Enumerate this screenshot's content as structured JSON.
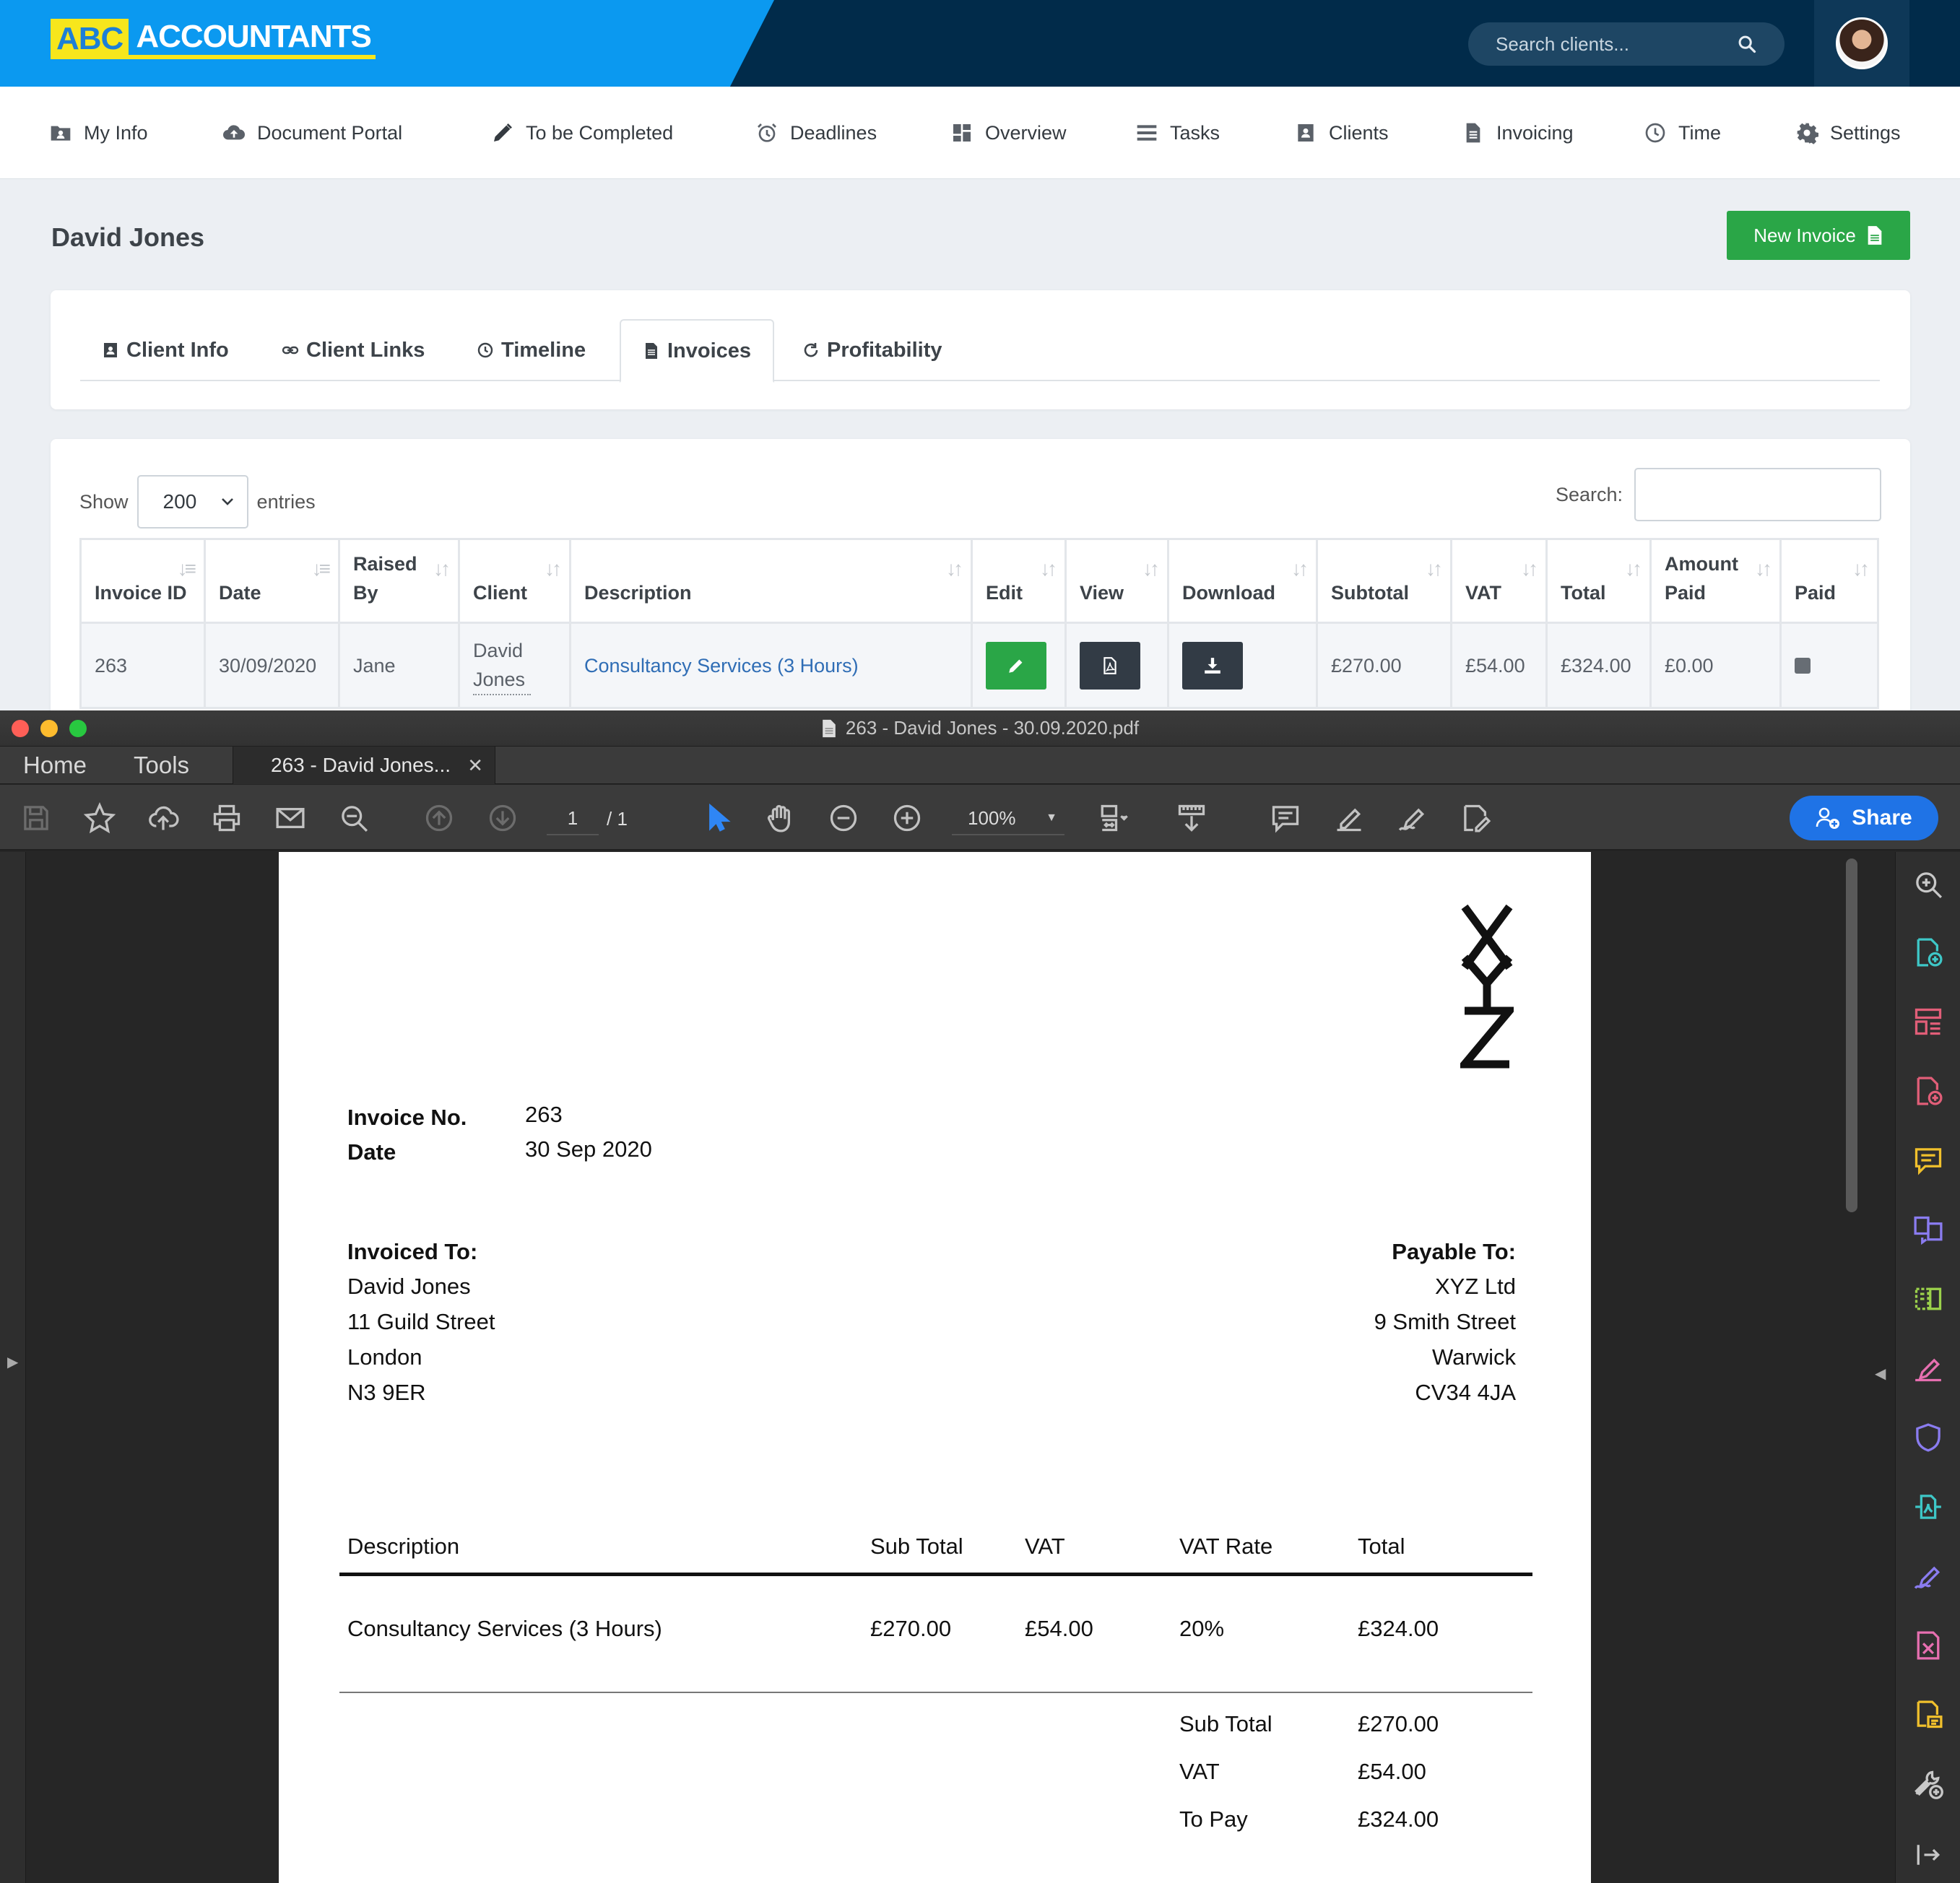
{
  "app": {
    "brand_abc": "ABC",
    "brand_accountants": "ACCOUNTANTS",
    "search_placeholder": "Search clients..."
  },
  "nav": [
    {
      "label": "My Info",
      "icon": "folder-user-icon"
    },
    {
      "label": "Document Portal",
      "icon": "cloud-upload-icon"
    },
    {
      "label": "To be Completed",
      "icon": "pencil-icon"
    },
    {
      "label": "Deadlines",
      "icon": "alarm-clock-icon"
    },
    {
      "label": "Overview",
      "icon": "dashboard-icon"
    },
    {
      "label": "Tasks",
      "icon": "list-icon"
    },
    {
      "label": "Clients",
      "icon": "contact-card-icon"
    },
    {
      "label": "Invoicing",
      "icon": "file-invoice-icon"
    },
    {
      "label": "Time",
      "icon": "clock-icon"
    },
    {
      "label": "Settings",
      "icon": "gear-icon"
    }
  ],
  "page": {
    "client_name": "David Jones",
    "new_invoice_label": "New Invoice"
  },
  "tabs": [
    {
      "label": "Client Info",
      "active": false
    },
    {
      "label": "Client Links",
      "active": false
    },
    {
      "label": "Timeline",
      "active": false
    },
    {
      "label": "Invoices",
      "active": true
    },
    {
      "label": "Profitability",
      "active": false
    }
  ],
  "table": {
    "show_label": "Show",
    "entries_value": "200",
    "entries_label": "entries",
    "search_label": "Search:",
    "columns": [
      "Invoice ID",
      "Date",
      "Raised By",
      "Client",
      "Description",
      "Edit",
      "View",
      "Download",
      "Subtotal",
      "VAT",
      "Total",
      "Amount Paid",
      "Paid"
    ],
    "rows": [
      {
        "id": "263",
        "date": "30/09/2020",
        "raised_by": "Jane",
        "client": "David Jones",
        "description": "Consultancy Services (3 Hours)",
        "subtotal": "£270.00",
        "vat": "£54.00",
        "total": "£324.00",
        "amount_paid": "£0.00",
        "paid": false
      }
    ]
  },
  "pdf_viewer": {
    "window_title": "263 - David Jones - 30.09.2020.pdf",
    "home_tab": "Home",
    "tools_tab": "Tools",
    "doc_tab": "263 - David Jones...",
    "page_current": "1",
    "page_total": "/ 1",
    "zoom": "100%",
    "share_label": "Share",
    "accent": "#1f73e6"
  },
  "invoice": {
    "logo_text": "XYZ",
    "invoice_no_label": "Invoice No.",
    "invoice_no": "263",
    "date_label": "Date",
    "date": "30 Sep 2020",
    "invoiced_to_label": "Invoiced To:",
    "invoiced_to": [
      "David Jones",
      "11 Guild Street",
      "London",
      "N3 9ER"
    ],
    "payable_to_label": "Payable To:",
    "payable_to": [
      "XYZ Ltd",
      "9 Smith Street",
      "Warwick",
      "CV34 4JA"
    ],
    "columns": [
      "Description",
      "Sub Total",
      "VAT",
      "VAT Rate",
      "Total"
    ],
    "lines": [
      {
        "description": "Consultancy Services (3 Hours)",
        "sub_total": "£270.00",
        "vat": "£54.00",
        "vat_rate": "20%",
        "total": "£324.00"
      }
    ],
    "summary": [
      {
        "label": "Sub Total",
        "value": "£270.00"
      },
      {
        "label": "VAT",
        "value": "£54.00"
      },
      {
        "label": "To Pay",
        "value": "£324.00"
      }
    ]
  }
}
